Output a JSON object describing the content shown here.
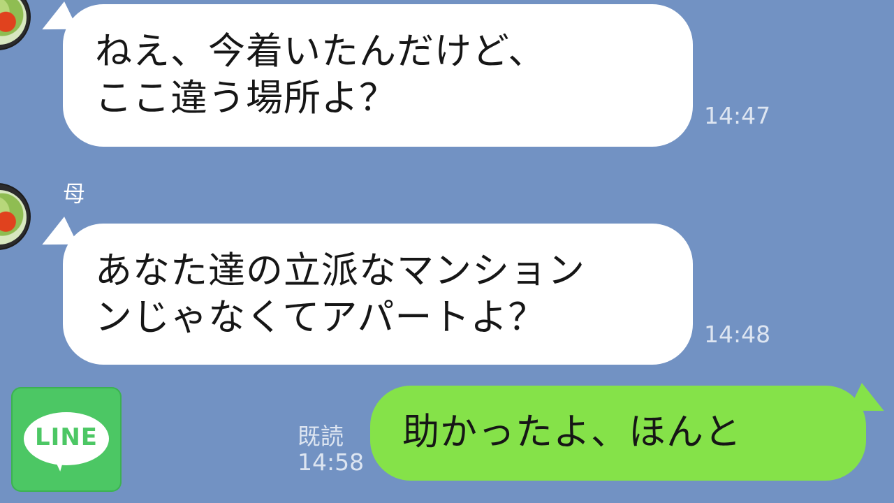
{
  "sender_name": "母",
  "messages": [
    {
      "direction": "incoming",
      "lines": [
        "ねえ、今着いたんだけど、",
        "ここ違う場所よ？"
      ],
      "time": "14:47"
    },
    {
      "direction": "incoming",
      "lines": [
        "あなた達の立派なマンション",
        "ンじゃなくてアパートよ？"
      ],
      "time": "14:48"
    },
    {
      "direction": "outgoing",
      "lines": [
        "助かったよ、ほんと"
      ],
      "read_label": "既読",
      "time": "14:58"
    }
  ],
  "logo": {
    "text": "LINE",
    "color": "#4cc764"
  },
  "colors": {
    "background": "#7292c3",
    "incoming_bubble": "#ffffff",
    "outgoing_bubble": "#85e249",
    "meta_text": "#dde5f1"
  },
  "icons": {
    "avatar": "salad-photo-avatar"
  }
}
